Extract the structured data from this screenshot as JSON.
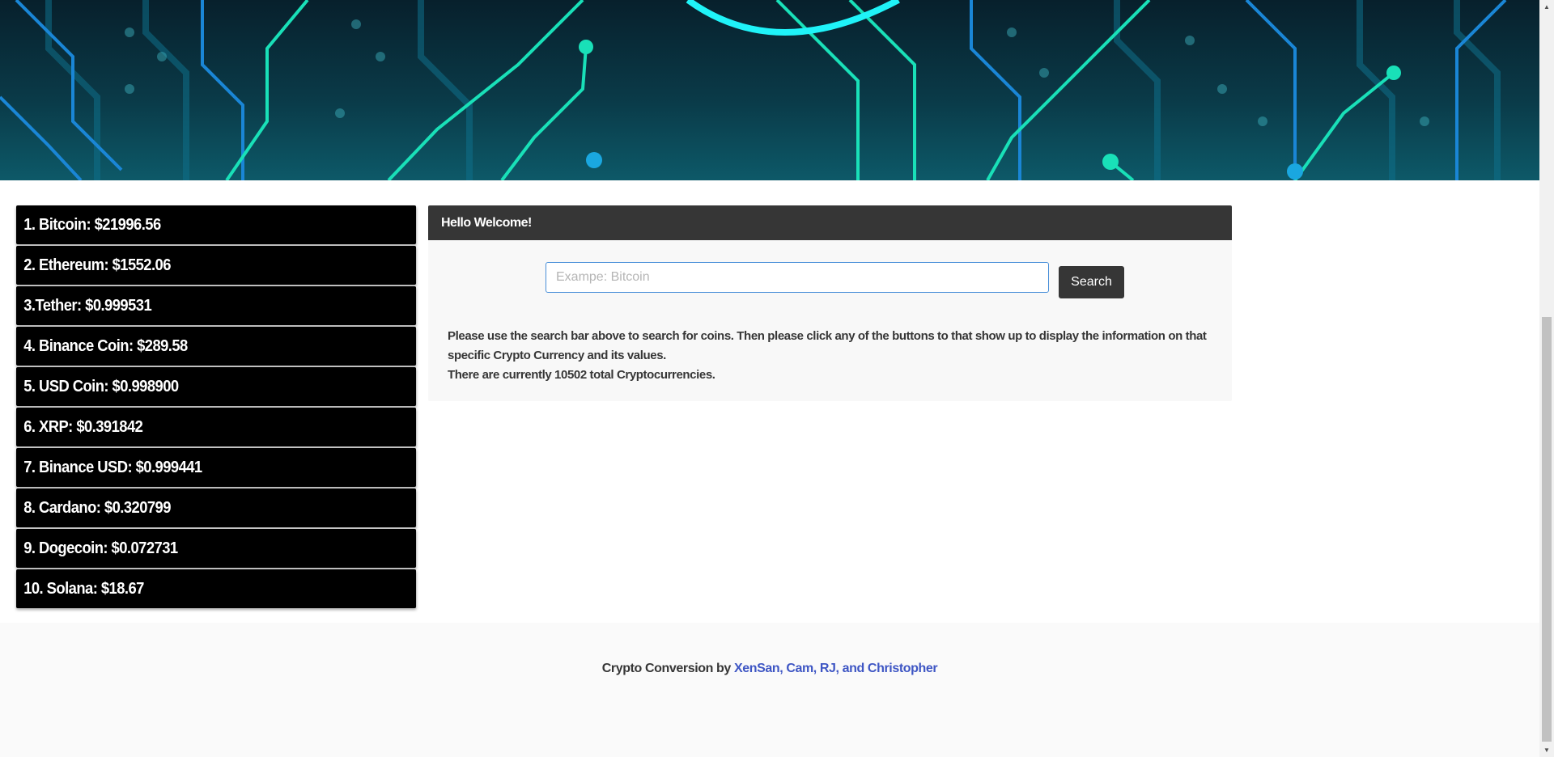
{
  "coins": [
    {
      "label": "1. Bitcoin: $21996.56"
    },
    {
      "label": "2. Ethereum: $1552.06"
    },
    {
      "label": "3.Tether: $0.999531"
    },
    {
      "label": "4. Binance Coin: $289.58"
    },
    {
      "label": "5. USD Coin: $0.998900"
    },
    {
      "label": "6. XRP: $0.391842"
    },
    {
      "label": "7. Binance USD: $0.999441"
    },
    {
      "label": "8. Cardano: $0.320799"
    },
    {
      "label": "9. Dogecoin: $0.072731"
    },
    {
      "label": "10. Solana: $18.67"
    }
  ],
  "welcome": {
    "title": "Hello Welcome!",
    "search_placeholder": "Exampe: Bitcoin",
    "search_value": "",
    "search_button": "Search",
    "instructions": "Please use the search bar above to search for coins. Then please click any of the buttons to that show up to display the information on that specific Crypto Currency and its values.",
    "total_text": "There are currently 10502 total Cryptocurrencies."
  },
  "footer": {
    "prefix": "Crypto Conversion by",
    "authors": "XenSan, Cam, RJ, and Christopher"
  },
  "colors": {
    "coin_bg": "#000000",
    "card_header": "#363636",
    "link": "#3e56c4",
    "accent_circuit": "#19e0b8"
  }
}
